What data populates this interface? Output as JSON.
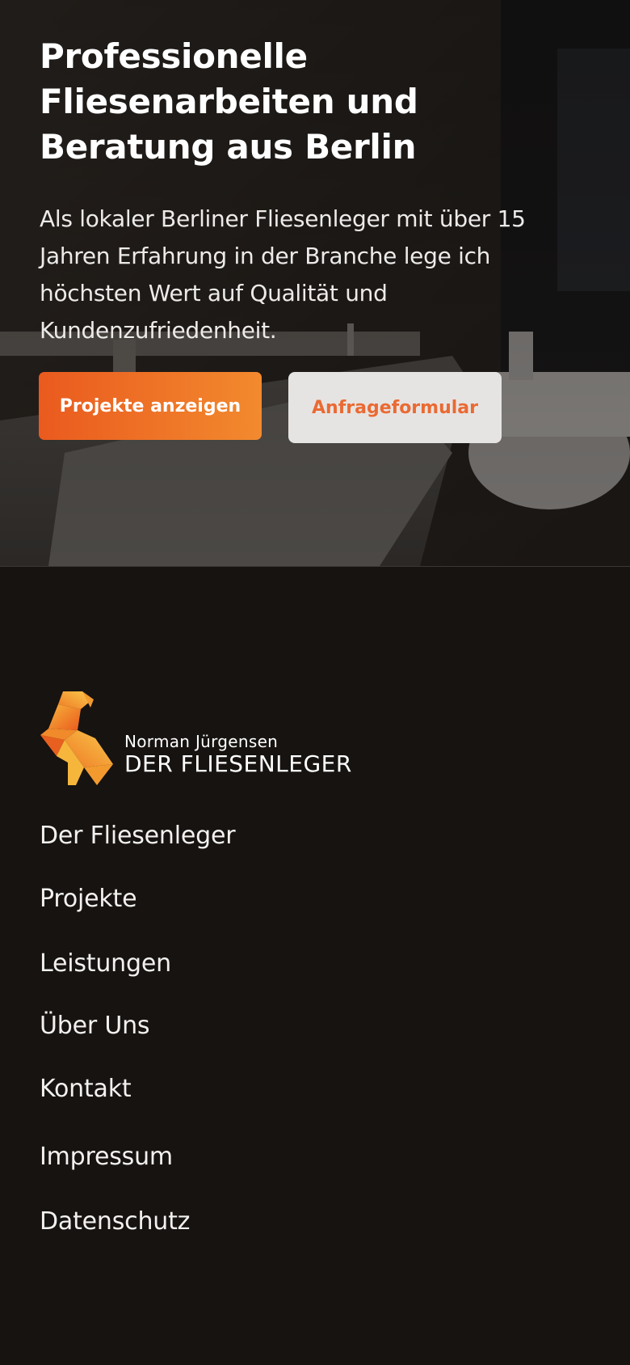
{
  "hero": {
    "title": "Professionelle Fliesenarbeiten und Beratung aus Berlin",
    "text": "Als lokaler Berliner Fliesenleger mit über 15 Jahren Erfahrung in der Branche lege ich höchsten Wert auf Qualität und Kundenzufriedenheit.",
    "primary_button": "Projekte anzeigen",
    "secondary_button": "Anfrageformular",
    "background_image": "dark-bathroom-photo"
  },
  "footer": {
    "logo": {
      "icon": "origami-bird-logo-icon",
      "name": "Norman Jürgensen",
      "subtitle": "DER FLIESENLEGER"
    },
    "nav": [
      {
        "label": "Der Fliesenleger"
      },
      {
        "label": "Projekte"
      },
      {
        "label": "Leistungen"
      },
      {
        "label": "Über Uns"
      },
      {
        "label": "Kontakt"
      },
      {
        "label": "Impressum"
      },
      {
        "label": "Datenschutz"
      }
    ]
  },
  "colors": {
    "accent_start": "#ea5a1e",
    "accent_end": "#f28a2e",
    "footer_bg": "#161311",
    "secondary_button_bg": "#e6e4e2",
    "secondary_button_text": "#ea6a33"
  }
}
